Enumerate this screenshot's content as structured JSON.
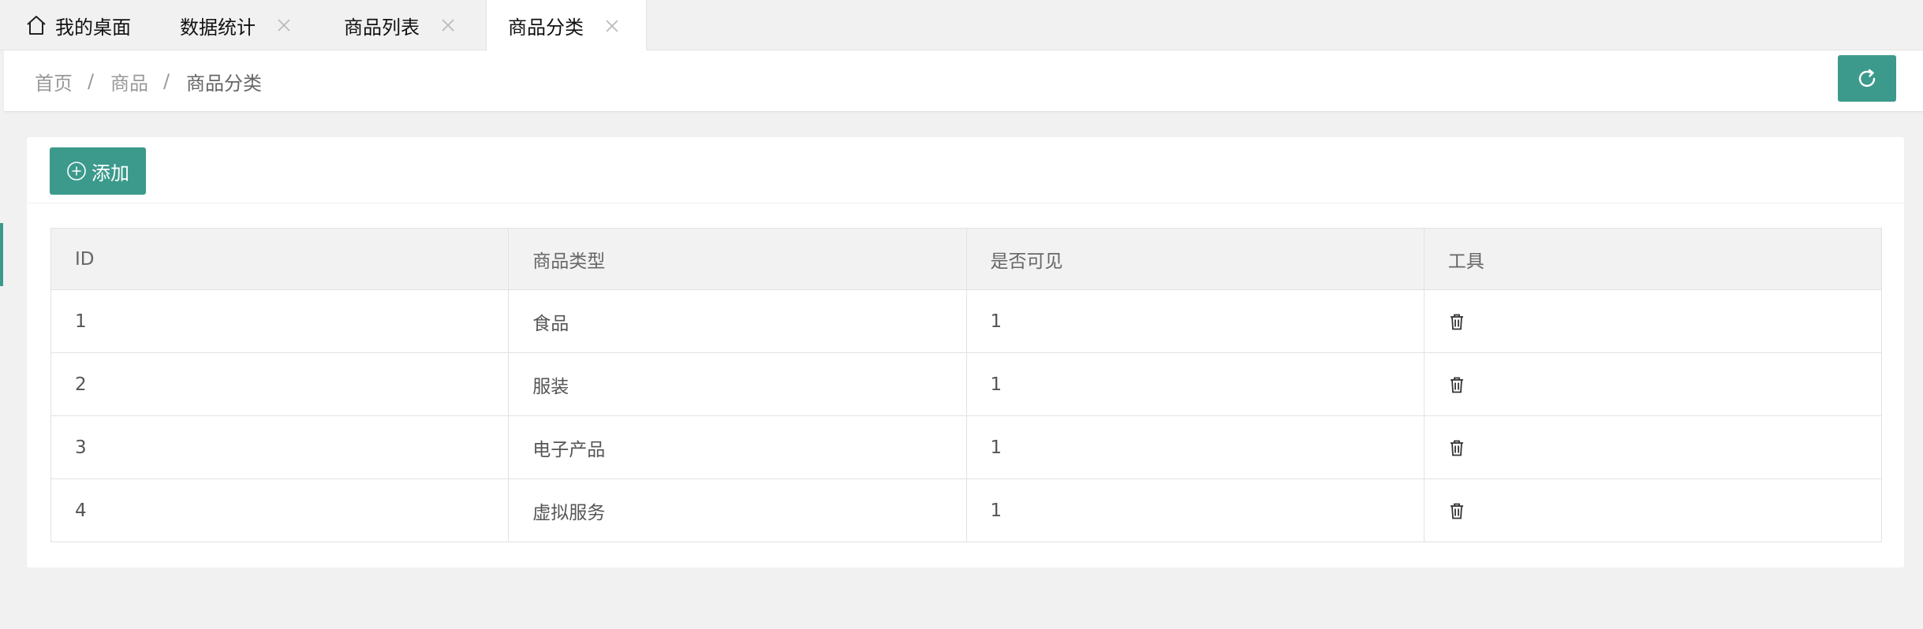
{
  "tabs": [
    {
      "label": "我的桌面",
      "icon": "home-icon",
      "closable": false,
      "active": false
    },
    {
      "label": "数据统计",
      "closable": true,
      "active": false
    },
    {
      "label": "商品列表",
      "closable": true,
      "active": false
    },
    {
      "label": "商品分类",
      "closable": true,
      "active": true
    }
  ],
  "breadcrumb": {
    "items": [
      "首页",
      "商品",
      "商品分类"
    ],
    "separator": "/"
  },
  "toolbar": {
    "refresh_icon": "refresh-icon",
    "add_label": "添加",
    "add_icon": "plus-circle-icon"
  },
  "table": {
    "columns": [
      "ID",
      "商品类型",
      "是否可见",
      "工具"
    ],
    "rows": [
      {
        "id": "1",
        "type": "食品",
        "visible": "1",
        "tool_icon": "trash-icon"
      },
      {
        "id": "2",
        "type": "服装",
        "visible": "1",
        "tool_icon": "trash-icon"
      },
      {
        "id": "3",
        "type": "电子产品",
        "visible": "1",
        "tool_icon": "trash-icon"
      },
      {
        "id": "4",
        "type": "虚拟服务",
        "visible": "1",
        "tool_icon": "trash-icon"
      }
    ]
  },
  "colors": {
    "accent": "#3c9a8c",
    "page_bg": "#f1f1f1",
    "header_bg": "#f2f2f2",
    "border": "#e2e2e2"
  }
}
